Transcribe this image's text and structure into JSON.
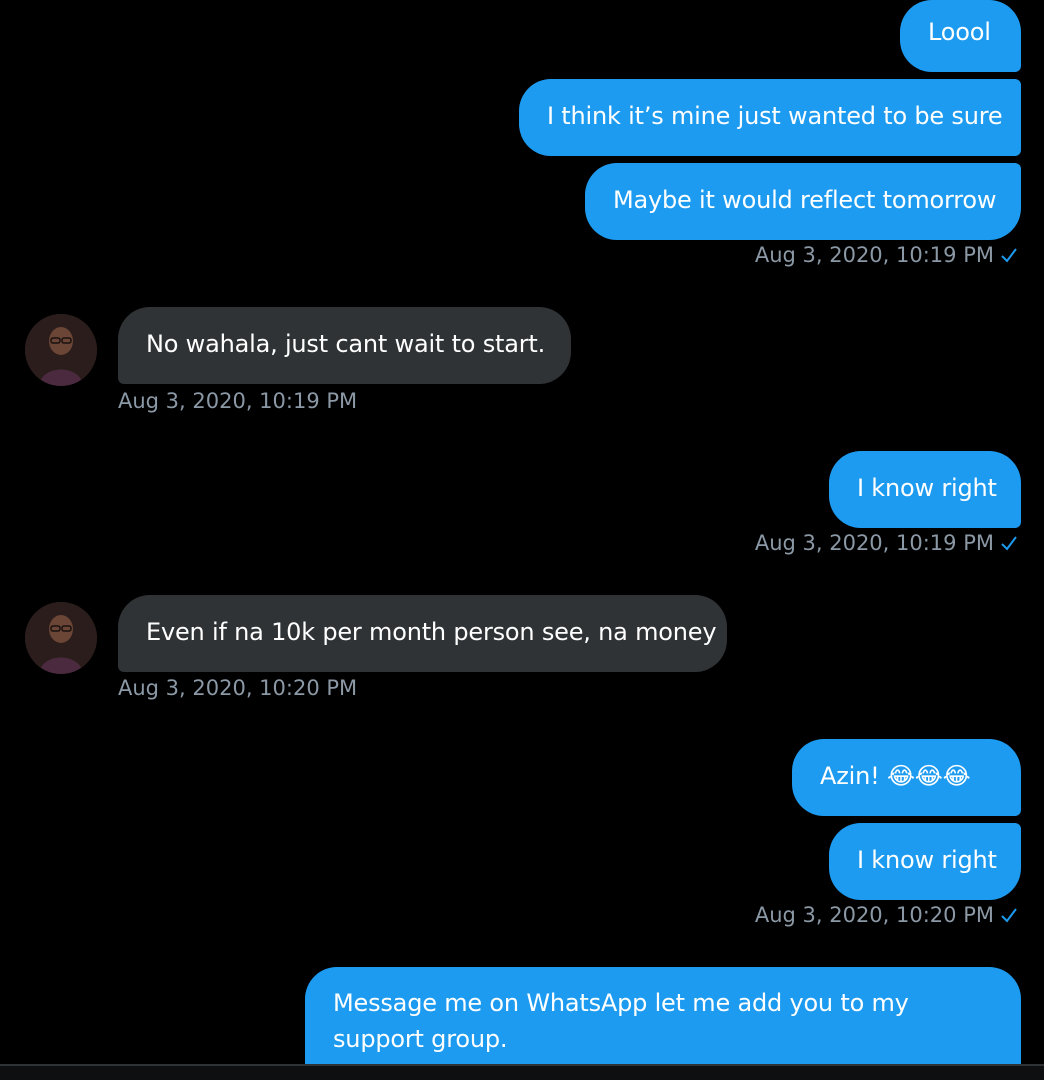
{
  "conversation": {
    "messages": [
      {
        "id": "m1",
        "direction": "outgoing",
        "text": "Loool"
      },
      {
        "id": "m2",
        "direction": "outgoing",
        "text": "I think it’s mine just wanted to be sure"
      },
      {
        "id": "m3",
        "direction": "outgoing",
        "text": "Maybe it would reflect tomorrow",
        "timestamp": "Aug 3, 2020, 10:19 PM",
        "read": true
      },
      {
        "id": "m4",
        "direction": "incoming",
        "text": "No wahala, just cant wait to start.",
        "timestamp": "Aug 3, 2020, 10:19 PM"
      },
      {
        "id": "m5",
        "direction": "outgoing",
        "text": "I know right",
        "timestamp": "Aug 3, 2020, 10:19 PM",
        "read": true
      },
      {
        "id": "m6",
        "direction": "incoming",
        "text": "Even if na 10k per month person see, na money",
        "timestamp": "Aug 3, 2020, 10:20 PM"
      },
      {
        "id": "m7",
        "direction": "outgoing",
        "text": "Azin! 😂😂😂"
      },
      {
        "id": "m8",
        "direction": "outgoing",
        "text": "I know right",
        "timestamp": "Aug 3, 2020, 10:20 PM",
        "read": true
      },
      {
        "id": "m9",
        "direction": "outgoing",
        "text": "Message me on WhatsApp let me add you to my support group."
      }
    ]
  },
  "colors": {
    "background": "#000000",
    "outgoing_bubble": "#1d9bf0",
    "incoming_bubble": "#2f3336",
    "timestamp_text": "#8b98a5",
    "read_check": "#1d9bf0"
  },
  "icons": {
    "read_receipt": "checkmark-icon",
    "contact_avatar": "avatar"
  }
}
